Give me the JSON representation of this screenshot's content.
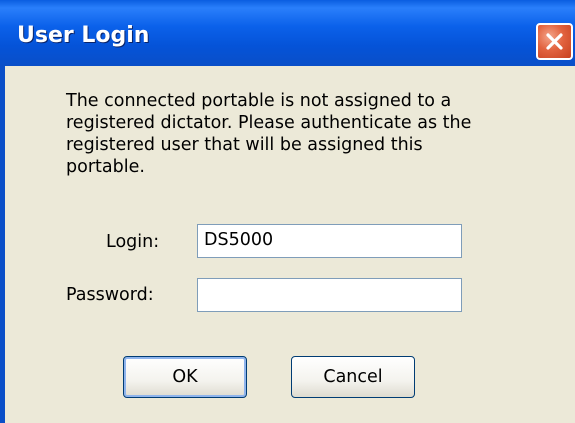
{
  "window": {
    "title": "User Login",
    "colors": {
      "titlebar": "#0b61ea",
      "close_button": "#e2633f",
      "dialog_background": "#ece9d8"
    }
  },
  "message": {
    "text": "The connected portable is not assigned to a\nregistered dictator.  Please authenticate as the\nregistered user that will be assigned this\nportable."
  },
  "form": {
    "login_label": "Login:",
    "login_value": "DS5000",
    "password_label": "Password:",
    "password_value": ""
  },
  "buttons": {
    "ok_label": "OK",
    "cancel_label": "Cancel"
  },
  "icons": {
    "close": "close-icon"
  }
}
